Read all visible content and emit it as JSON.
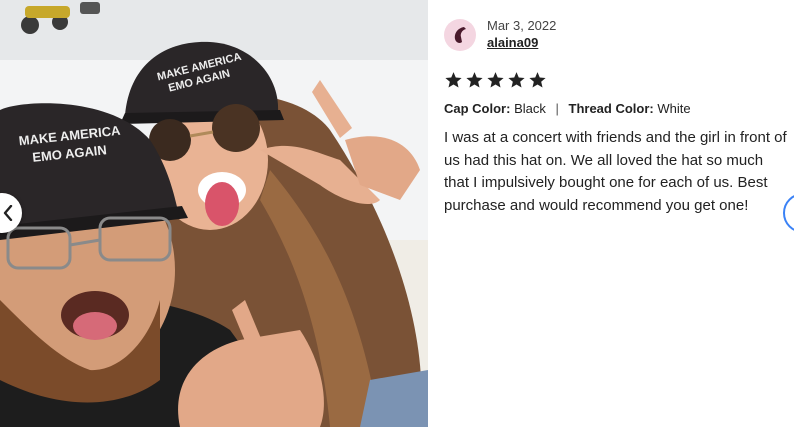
{
  "photo": {
    "hat_text_line1": "MAKE AMERICA",
    "hat_text_line2": "EMO AGAIN",
    "prev_icon": "chevron-left-icon"
  },
  "review": {
    "date": "Mar 3, 2022",
    "username": "alaina09",
    "rating": 5,
    "options": {
      "cap_label": "Cap Color:",
      "cap_value": "Black",
      "separator": "|",
      "thread_label": "Thread Color:",
      "thread_value": "White"
    },
    "text": "I was at a concert with friends and the girl in front of us had this hat on. We all loved the hat so much that I impulsively bought one for each of us. Best purchase and would recommend you get one!"
  },
  "colors": {
    "avatar_bg": "#f4d6e1",
    "avatar_mark": "#4a1a2c",
    "star": "#222222",
    "next_ring": "#3b82f6"
  }
}
